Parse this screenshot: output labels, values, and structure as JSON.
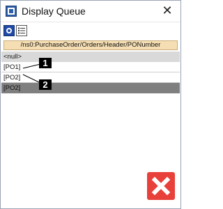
{
  "window": {
    "title": "Display Queue"
  },
  "toolbar": {
    "buttons": [
      "queue-icon",
      "list-icon"
    ]
  },
  "path_bar": {
    "text": "/ns0:PurchaseOrder/Orders/Header/PONumber"
  },
  "rows": [
    "<null>",
    "[PO1]",
    "[PO2]",
    "[PO2]"
  ],
  "callouts": [
    "1",
    "2"
  ],
  "colors": {
    "path_bg": "#f5deb3",
    "null_row": "#d9d9d9",
    "dark_row": "#7f7f7f",
    "close_red": "#e8403a"
  }
}
